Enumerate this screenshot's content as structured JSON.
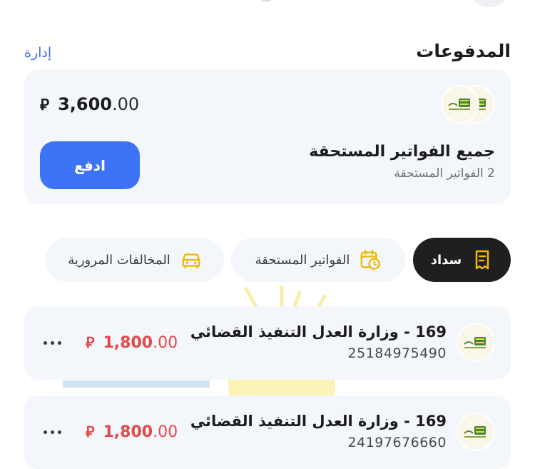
{
  "payments": {
    "title": "المدفوعات",
    "manage_label": "إدارة",
    "summary": {
      "amount_int": "3,600",
      "amount_dec": ".00",
      "currency_symbol": "⃁",
      "title": "جميع الفواتير المستحقة",
      "subtitle": "2 الفواتير المستحقة",
      "pay_label": "ادفع"
    }
  },
  "tabs": [
    {
      "label": "سداد",
      "icon": "receipt-icon",
      "active": true
    },
    {
      "label": "الفواتير المستحقة",
      "icon": "calendar-clock-icon",
      "active": false
    },
    {
      "label": "المخالفات المرورية",
      "icon": "car-icon",
      "active": false
    }
  ],
  "bills": [
    {
      "title": "169 - وزارة العدل التنفيذ القضائي",
      "number": "25184975490",
      "amount_int": "1,800",
      "amount_dec": ".00",
      "currency_symbol": "⃁"
    },
    {
      "title": "169 - وزارة العدل التنفيذ القضائي",
      "number": "24197676660",
      "amount_int": "1,800",
      "amount_dec": ".00",
      "currency_symbol": "⃁"
    }
  ],
  "colors": {
    "accent": "#3d73f5",
    "amount_due": "#e54848",
    "tab_active": "#1f1f21",
    "icon_yellow": "#f2b705",
    "card_bg": "#f3f6fa"
  }
}
